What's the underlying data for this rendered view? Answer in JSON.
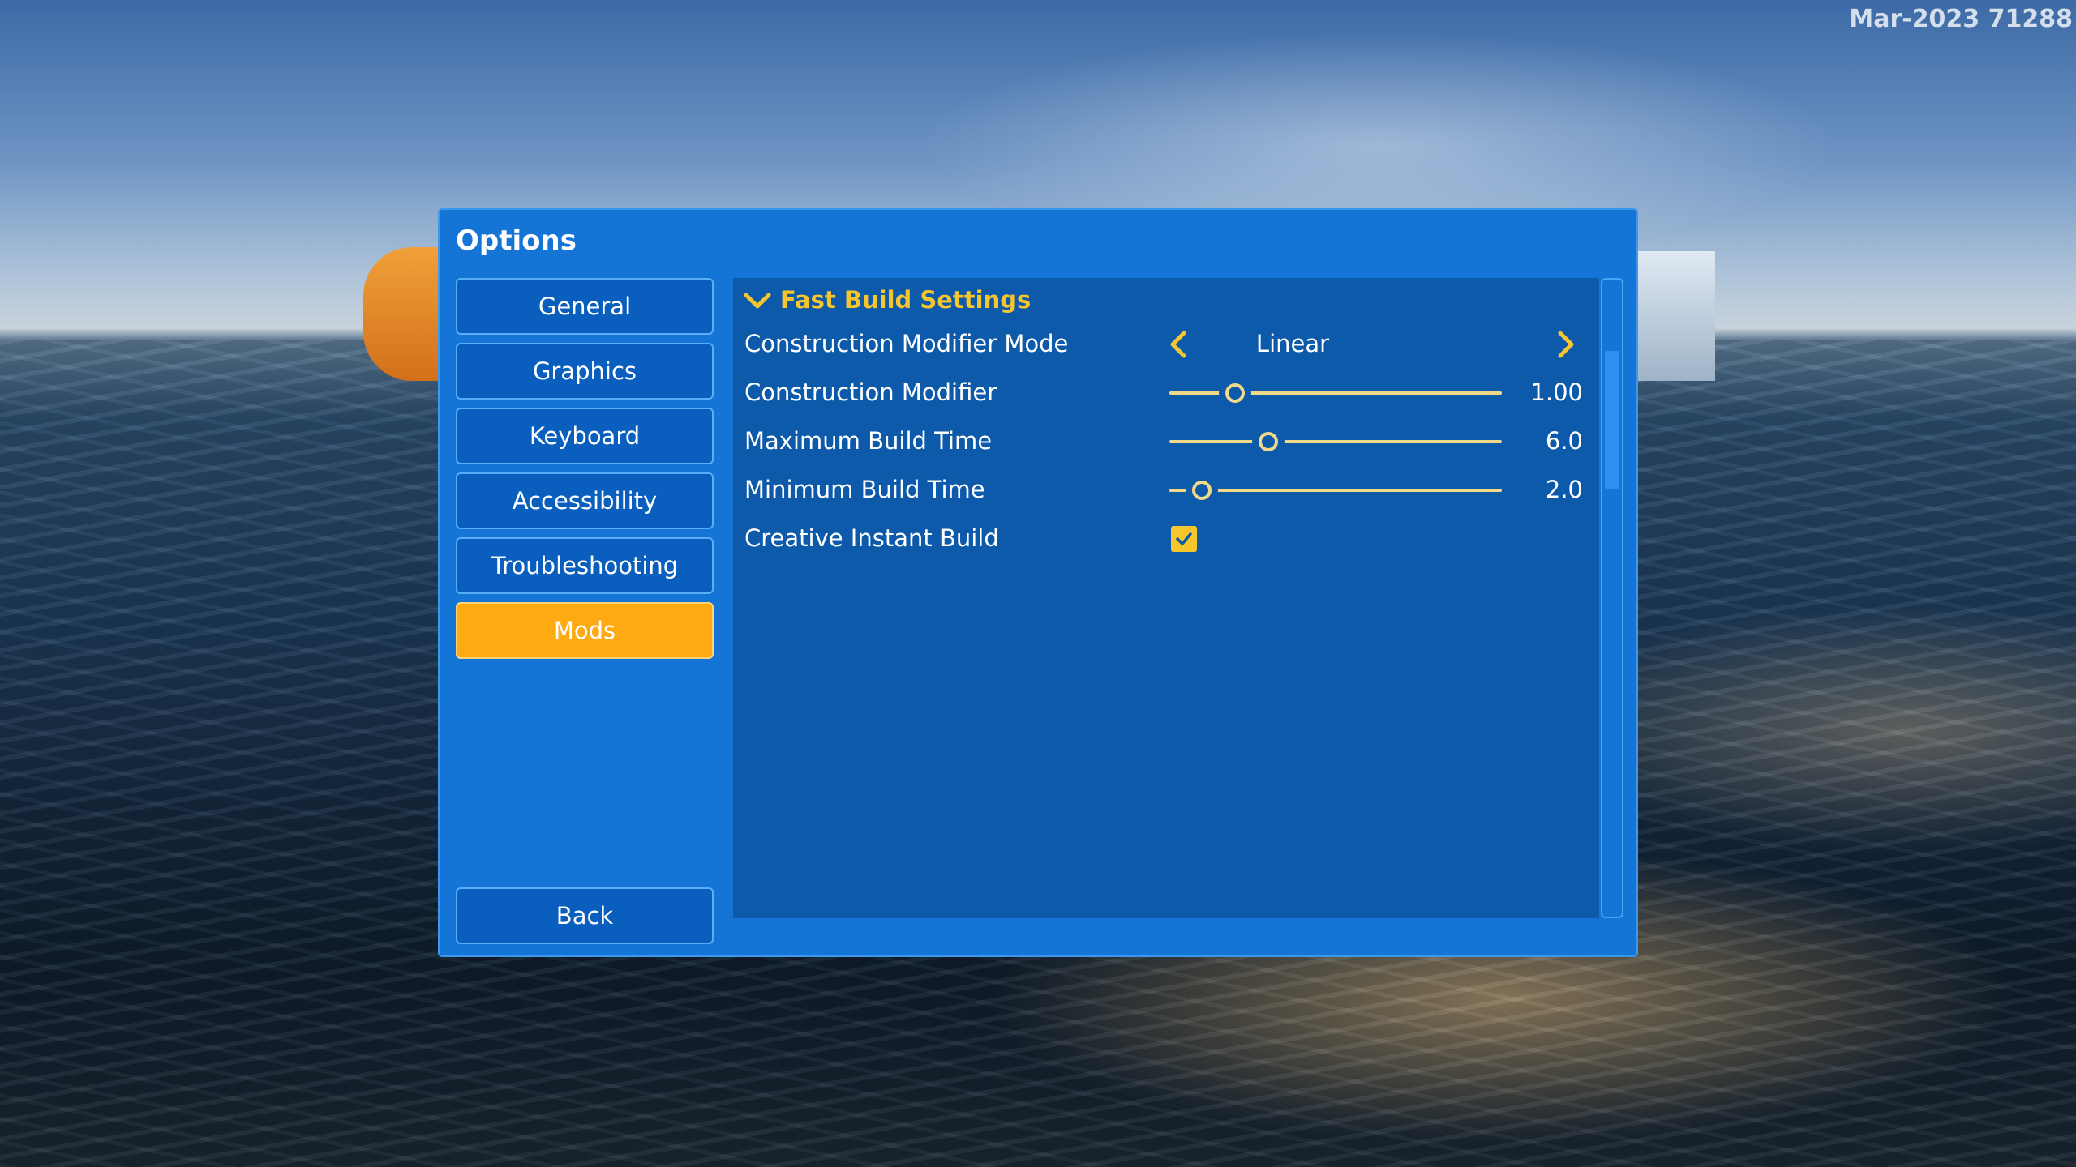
{
  "build_label": "Mar-2023 71288",
  "options": {
    "title": "Options",
    "menu": [
      {
        "label": "General"
      },
      {
        "label": "Graphics"
      },
      {
        "label": "Keyboard"
      },
      {
        "label": "Accessibility"
      },
      {
        "label": "Troubleshooting"
      },
      {
        "label": "Mods"
      }
    ],
    "active_menu": "Mods",
    "back_label": "Back"
  },
  "fast_build": {
    "section_title": "Fast Build Settings",
    "construction_modifier_mode": {
      "label": "Construction Modifier Mode",
      "value": "Linear"
    },
    "construction_modifier": {
      "label": "Construction Modifier",
      "value": "1.00",
      "fraction": 0.2
    },
    "maximum_build_time": {
      "label": "Maximum Build Time",
      "value": "6.0",
      "fraction": 0.3
    },
    "minimum_build_time": {
      "label": "Minimum Build Time",
      "value": "2.0",
      "fraction": 0.1
    },
    "creative_instant_build": {
      "label": "Creative Instant Build",
      "checked": true
    }
  },
  "colors": {
    "panel": "#1575d6",
    "content": "#0d5aab",
    "accent_yellow": "#f7c52c",
    "active_tab": "#ffaa12"
  }
}
